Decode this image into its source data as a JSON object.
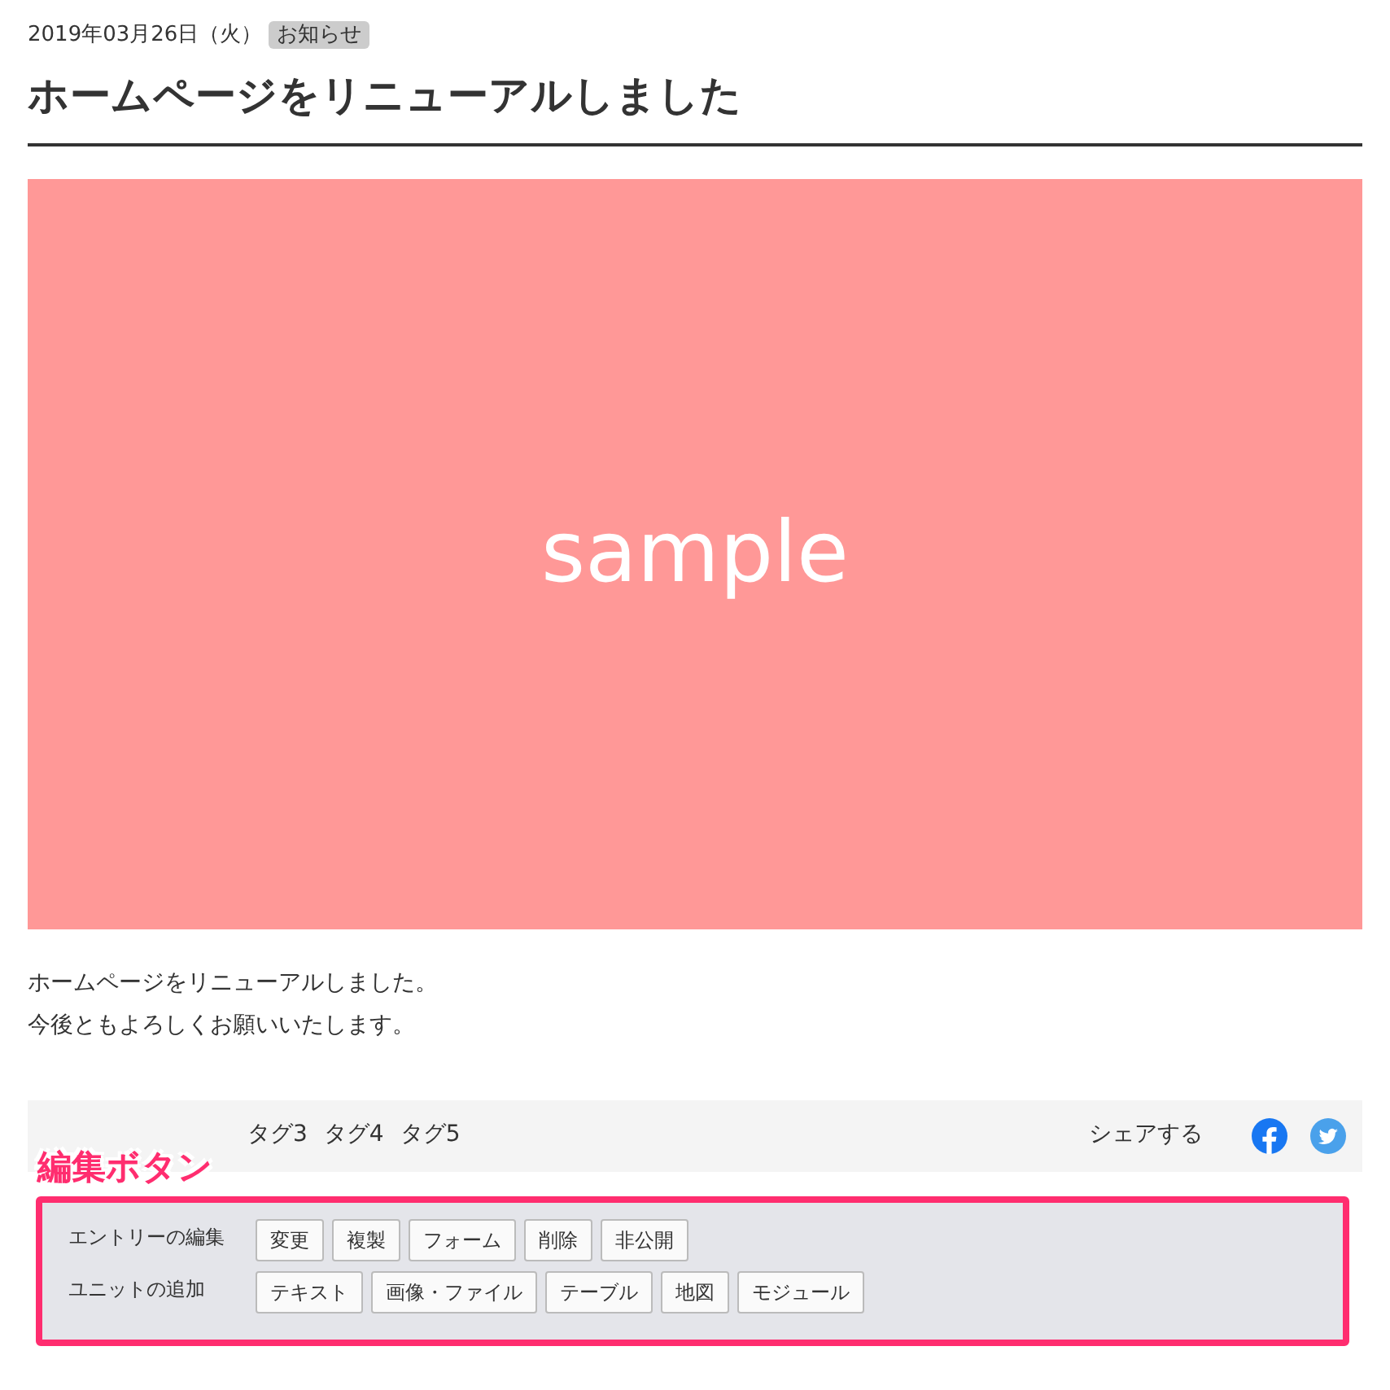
{
  "entry": {
    "date": "2019年03月26日（火）",
    "category": "お知らせ",
    "title": "ホームページをリニューアルしました"
  },
  "image": {
    "kind": "placeholder",
    "label": "sample"
  },
  "body": [
    "ホームページをリニューアルしました。",
    "今後ともよろしくお願いいたします。"
  ],
  "tags": [
    "タグ3",
    "タグ4",
    "タグ5"
  ],
  "share": {
    "label": "シェアする",
    "services": [
      {
        "kind": "facebook"
      },
      {
        "kind": "twitter"
      }
    ]
  },
  "callout": "編集ボタン",
  "edit_panel": {
    "rows": [
      {
        "label": "エントリーの編集",
        "buttons": [
          "変更",
          "複製",
          "フォーム",
          "削除",
          "非公開"
        ]
      },
      {
        "label": "ユニットの追加",
        "buttons": [
          "テキスト",
          "画像・ファイル",
          "テーブル",
          "地図",
          "モジュール"
        ]
      }
    ]
  }
}
